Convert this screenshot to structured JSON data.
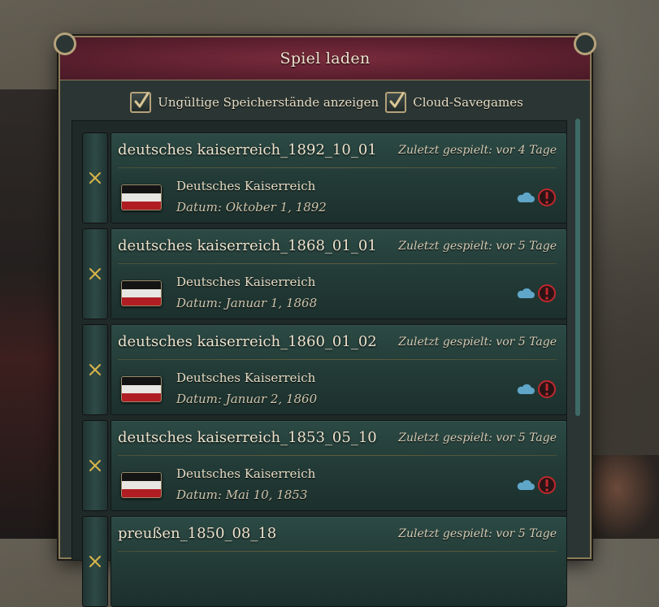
{
  "window": {
    "title": "Spiel laden"
  },
  "filters": [
    {
      "label": "Ungültige Speicherstände anzeigen",
      "checked": true
    },
    {
      "label": "Cloud-Savegames",
      "checked": true
    }
  ],
  "colors": {
    "flag_black": "#141414",
    "flag_white": "#e8e6e2",
    "flag_red": "#b01e24",
    "cloud": "#5fa6c9",
    "warning": "#c0282c",
    "delete_x": "#d9b54a"
  },
  "saves": [
    {
      "name": "deutsches kaiserreich_1892_10_01",
      "last_played": "Zuletzt gespielt: vor 4 Tage",
      "country": "Deutsches Kaiserreich",
      "date": "Datum: Oktober 1, 1892",
      "icons": [
        "cloud-icon",
        "warning-icon"
      ]
    },
    {
      "name": "deutsches kaiserreich_1868_01_01",
      "last_played": "Zuletzt gespielt: vor 5 Tage",
      "country": "Deutsches Kaiserreich",
      "date": "Datum: Januar 1, 1868",
      "icons": [
        "cloud-icon",
        "warning-icon"
      ]
    },
    {
      "name": "deutsches kaiserreich_1860_01_02",
      "last_played": "Zuletzt gespielt: vor 5 Tage",
      "country": "Deutsches Kaiserreich",
      "date": "Datum: Januar 2, 1860",
      "icons": [
        "cloud-icon",
        "warning-icon"
      ]
    },
    {
      "name": "deutsches kaiserreich_1853_05_10",
      "last_played": "Zuletzt gespielt: vor 5 Tage",
      "country": "Deutsches Kaiserreich",
      "date": "Datum: Mai 10, 1853",
      "icons": [
        "cloud-icon",
        "warning-icon"
      ]
    },
    {
      "name": "preußen_1850_08_18",
      "last_played": "Zuletzt gespielt: vor 5 Tage",
      "country": "",
      "date": "",
      "icons": []
    }
  ]
}
